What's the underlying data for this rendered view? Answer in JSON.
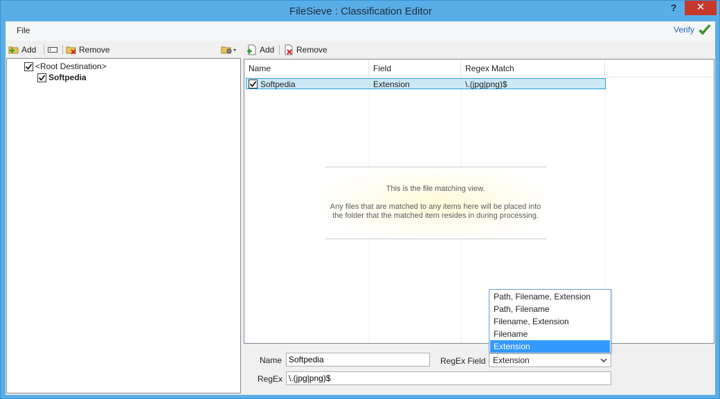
{
  "window": {
    "title": "FileSieve : Classification Editor",
    "help": "?",
    "close": "✕"
  },
  "menu": {
    "file": "File",
    "verify": "Verify"
  },
  "left_toolbar": {
    "add": "Add",
    "remove": "Remove"
  },
  "right_toolbar": {
    "add": "Add",
    "remove": "Remove"
  },
  "tree": [
    {
      "label": "<Root Destination>",
      "checked": true
    },
    {
      "label": "Softpedia",
      "checked": true
    }
  ],
  "grid": {
    "columns": [
      "Name",
      "Field",
      "Regex Match"
    ],
    "rows": [
      {
        "name": "Softpedia",
        "field": "Extension",
        "regex": "\\.(jpg|png)$",
        "checked": true
      }
    ],
    "empty_hint_title": "This is the file matching view.",
    "empty_hint_body_1": "Any files that are matched to any items here will be placed into",
    "empty_hint_body_2": "the folder that the matched item resides in during processing."
  },
  "form": {
    "name_label": "Name",
    "name_value": "Softpedia",
    "regex_field_label": "RegEx Field",
    "regex_field_value": "Extension",
    "regex_label": "RegEx",
    "regex_value": "\\.(jpg|png)$",
    "dropdown_options": [
      "Path, Filename, Extension",
      "Path, Filename",
      "Filename, Extension",
      "Filename",
      "Extension"
    ],
    "dropdown_selected": "Extension"
  },
  "colors": {
    "titlebar": "#5aaee8",
    "selection": "#3399ff",
    "row_highlight": "#cbe8f6",
    "close": "#c7382c"
  }
}
